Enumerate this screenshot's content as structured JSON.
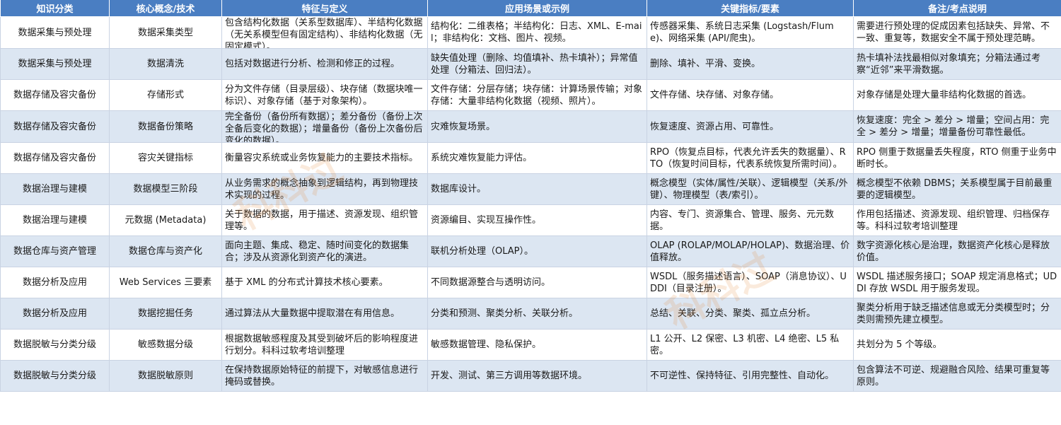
{
  "headers": [
    "知识分类",
    "核心概念/技术",
    "特征与定义",
    "应用场景或示例",
    "关键指标/要素",
    "备注/考点说明"
  ],
  "rows": [
    [
      "数据采集与预处理",
      "数据采集类型",
      "包含结构化数据（关系型数据库）、半结构化数据（无关系模型但有固定结构）、非结构化数据（无固定模式）。",
      "结构化：二维表格；半结构化：日志、XML、E-mail；非结构化：文档、图片、视频。",
      "传感器采集、系统日志采集 (Logstash/Flume)、网络采集 (API/爬虫)。",
      "需要进行预处理的促成因素包括缺失、异常、不一致、重复等，数据安全不属于预处理范畴。"
    ],
    [
      "数据采集与预处理",
      "数据清洗",
      "包括对数据进行分析、检测和修正的过程。",
      "缺失值处理（删除、均值填补、热卡填补）；异常值处理（分箱法、回归法）。",
      "删除、填补、平滑、变换。",
      "热卡填补法找最相似对象填充；分箱法通过考察“近邻”来平滑数据。"
    ],
    [
      "数据存储及容灾备份",
      "存储形式",
      "分为文件存储（目录层级）、块存储（数据块唯一标识）、对象存储（基于对象架构）。",
      "文件存储：分层存储；块存储：计算场景传输；对象存储：大量非结构化数据（视频、照片）。",
      "文件存储、块存储、对象存储。",
      "对象存储是处理大量非结构化数据的首选。"
    ],
    [
      "数据存储及容灾备份",
      "数据备份策略",
      "完全备份（备份所有数据）；差分备份（备份上次全备后变化的数据）；增量备份（备份上次备份后变化的数据）。",
      "灾难恢复场景。",
      "恢复速度、资源占用、可靠性。",
      "恢复速度：完全 > 差分 > 增量；空间占用：完全 > 差分 > 增量；增量备份可靠性最低。"
    ],
    [
      "数据存储及容灾备份",
      "容灾关键指标",
      "衡量容灾系统或业务恢复能力的主要技术指标。",
      "系统灾难恢复能力评估。",
      "RPO（恢复点目标，代表允许丢失的数据量）、RTO（恢复时间目标，代表系统恢复所需时间）。",
      "RPO 侧重于数据量丢失程度，RTO 侧重于业务中断时长。"
    ],
    [
      "数据治理与建模",
      "数据模型三阶段",
      "从业务需求的概念抽象到逻辑结构，再到物理技术实现的过程。",
      "数据库设计。",
      "概念模型（实体/属性/关联）、逻辑模型（关系/外键）、物理模型（表/索引）。",
      "概念模型不依赖 DBMS；关系模型属于目前最重要的逻辑模型。"
    ],
    [
      "数据治理与建模",
      "元数据 (Metadata)",
      "关于数据的数据，用于描述、资源发现、组织管理等。",
      "资源编目、实现互操作性。",
      "内容、专门、资源集合、管理、服务、元元数据。",
      "作用包括描述、资源发现、组织管理、归档保存等。科科过软考培训整理"
    ],
    [
      "数据仓库与资产管理",
      "数据仓库与资产化",
      "面向主题、集成、稳定、随时间变化的数据集合；涉及从资源化到资产化的演进。",
      "联机分析处理（OLAP）。",
      "OLAP (ROLAP/MOLAP/HOLAP)、数据治理、价值释放。",
      "数字资源化核心是治理，数据资产化核心是释放价值。"
    ],
    [
      "数据分析及应用",
      "Web Services 三要素",
      "基于 XML 的分布式计算技术核心要素。",
      "不同数据源整合与透明访问。",
      "WSDL（服务描述语言）、SOAP（消息协议）、UDDI（目录注册）。",
      "WSDL 描述服务接口；SOAP 规定消息格式；UDDI 存放 WSDL 用于服务发现。"
    ],
    [
      "数据分析及应用",
      "数据挖掘任务",
      "通过算法从大量数据中提取潜在有用信息。",
      "分类和预测、聚类分析、关联分析。",
      "总结、关联、分类、聚类、孤立点分析。",
      "聚类分析用于缺乏描述信息或无分类模型时；分类则需预先建立模型。"
    ],
    [
      "数据脱敏与分类分级",
      "敏感数据分级",
      "根据数据敏感程度及其受到破坏后的影响程度进行划分。科科过软考培训整理",
      "敏感数据管理、隐私保护。",
      "L1 公开、L2 保密、L3 机密、L4 绝密、L5 私密。",
      "共划分为 5 个等级。"
    ],
    [
      "数据脱敏与分类分级",
      "数据脱敏原则",
      "在保持数据原始特征的前提下，对敏感信息进行掩码或替换。",
      "开发、测试、第三方调用等数据环境。",
      "不可逆性、保持特征、引用完整性、自动化。",
      "包含算法不可逆、规避融合风险、结果可重复等原则。"
    ]
  ]
}
